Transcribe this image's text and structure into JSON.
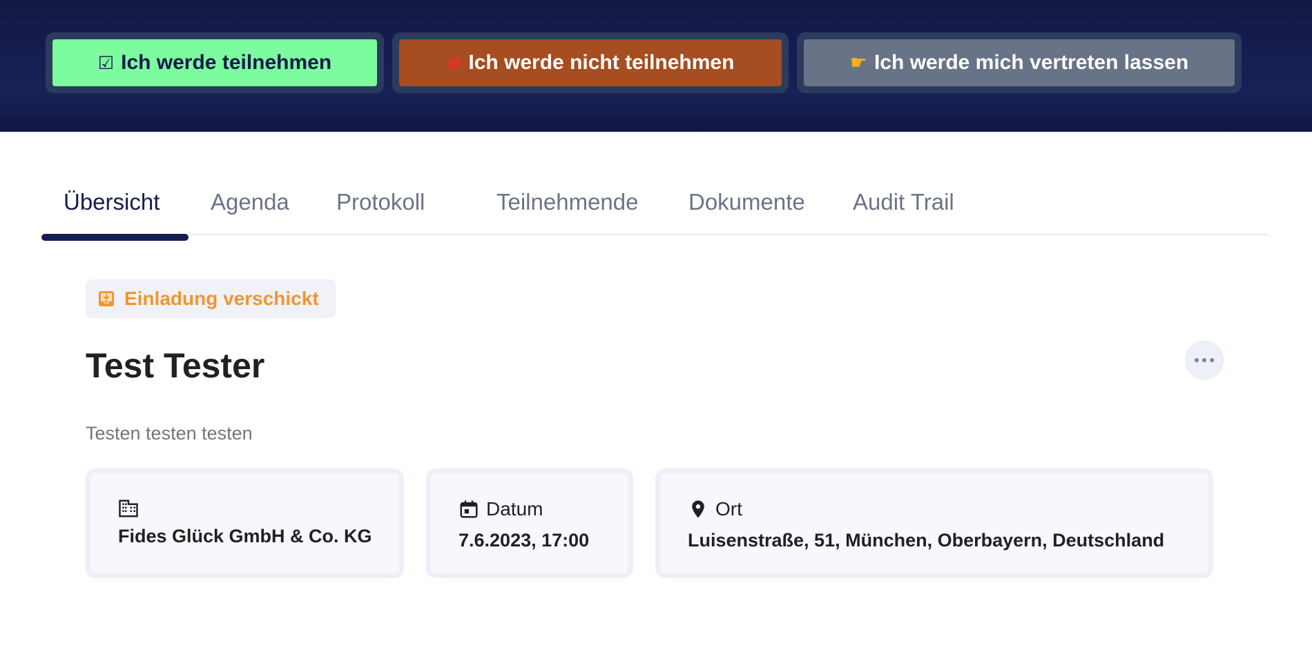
{
  "rsvp": {
    "attend": {
      "icon": "check-box-icon",
      "label": "Ich werde teilnehmen"
    },
    "decline": {
      "icon": "no-entry-icon",
      "label": "Ich werde nicht teilnehmen"
    },
    "proxy": {
      "icon": "pointing-hand-icon",
      "label": "Ich werde mich vertreten lassen"
    }
  },
  "tabs": [
    {
      "label": "Übersicht",
      "active": true
    },
    {
      "label": "Agenda",
      "active": false
    },
    {
      "label": "Protokoll",
      "active": false
    },
    {
      "label": "Teilnehmende",
      "active": false
    },
    {
      "label": "Dokumente",
      "active": false
    },
    {
      "label": "Audit Trail",
      "active": false
    }
  ],
  "status": {
    "icon": "inbox-icon",
    "label": "Einladung verschickt",
    "color": "#f09530"
  },
  "meeting": {
    "title": "Test Tester",
    "description": "Testen testen testen"
  },
  "cards": {
    "organization": {
      "icon": "building-icon",
      "value": "Fides Glück GmbH & Co. KG"
    },
    "date": {
      "icon": "calendar-icon",
      "label": "Datum",
      "value": "7.6.2023, 17:00"
    },
    "place": {
      "icon": "location-pin-icon",
      "label": "Ort",
      "value": "Luisenstraße, 51, München, Oberbayern, Deutschland"
    }
  },
  "colors": {
    "header_bg": "#161e52",
    "attend_green": "#7dfb9f",
    "decline_orange": "#a64d21",
    "proxy_grey": "#687387",
    "tab_active": "#141d52"
  }
}
